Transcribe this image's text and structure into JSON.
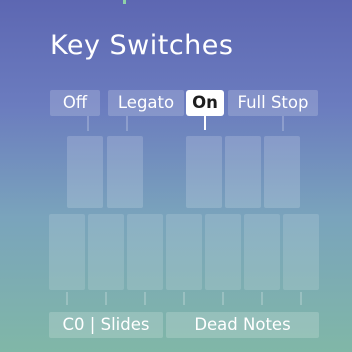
{
  "panel": {
    "title": "Key Switches"
  },
  "articulations": [
    {
      "label": "Off",
      "active": false
    },
    {
      "label": "Legato",
      "active": false
    },
    {
      "label": "On",
      "active": true
    },
    {
      "label": "Full Stop",
      "active": false
    }
  ],
  "ranges": [
    {
      "label": "C0 | Slides"
    },
    {
      "label": "Dead Notes"
    }
  ],
  "colors": {
    "gradient_top": "#5d67b2",
    "gradient_bottom": "#80b7a7",
    "active_label_bg": "#ffffff",
    "accent_tick": "#8fd1a8"
  }
}
